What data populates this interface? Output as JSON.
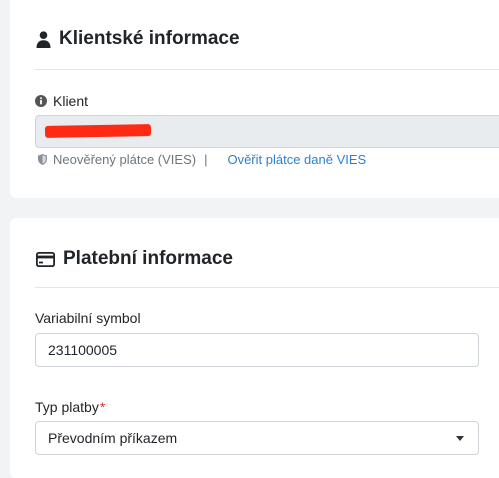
{
  "client_section": {
    "title": "Klientské informace",
    "title_icon": "user-icon",
    "client_label": "Klient",
    "client_label_icon": "info-circle-icon",
    "client_value_redacted": true,
    "vies_status_icon": "shield-icon",
    "vies_status": "Neověřený plátce (VIES)",
    "vies_separator": "|",
    "vies_verify_link": "Ověřit plátce daně VIES"
  },
  "payment_section": {
    "title": "Platební informace",
    "title_icon": "credit-card-icon",
    "variable_symbol_label": "Variabilní symbol",
    "variable_symbol_value": "231100005",
    "payment_type_label": "Typ platby",
    "payment_type_required_mark": "*",
    "payment_type_value": "Převodním příkazem"
  },
  "colors": {
    "page_bg": "#f2f3f5",
    "card_bg": "#ffffff",
    "link": "#2d7fd3",
    "required": "#e3342f",
    "redaction": "#ff2a14"
  }
}
